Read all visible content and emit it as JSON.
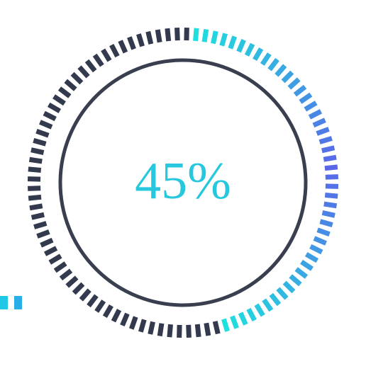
{
  "progress": {
    "label": "45%",
    "value": 45,
    "segments_total": 100
  },
  "colors": {
    "inactive": "#333a4e",
    "inner_ring": "#3a3f50",
    "text": "#27c8dd",
    "gradient_start": "#1ee0de",
    "gradient_mid": "#3c9bea",
    "gradient_end": "#5966e8"
  }
}
